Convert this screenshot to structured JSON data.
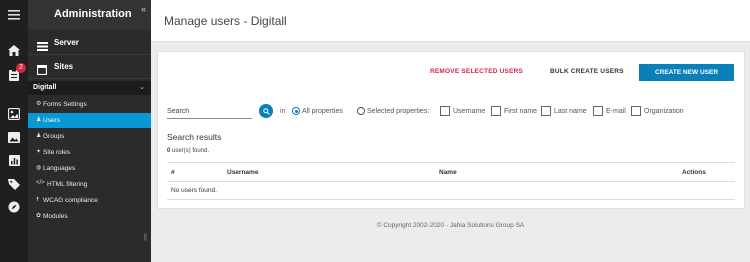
{
  "rail": {
    "icons": [
      "hamburger-icon",
      "home-icon",
      "tasks-icon",
      "tag-icon",
      "image-icon",
      "chart-icon",
      "label-icon",
      "compass-icon"
    ],
    "badge_count": "2",
    "badge_color": "#d9263b"
  },
  "sidebar": {
    "title": "Administration",
    "collapse_glyph": "«",
    "sections": [
      {
        "label": "Server",
        "icon": "server-icon"
      },
      {
        "label": "Sites",
        "icon": "sites-icon"
      }
    ],
    "site": {
      "label": "Digitall",
      "chevron": "⌄"
    },
    "items": [
      {
        "label": "Forms Settings",
        "icon": "gear-icon",
        "active": false
      },
      {
        "label": "Users",
        "icon": "user-icon",
        "active": true
      },
      {
        "label": "Groups",
        "icon": "group-icon",
        "active": false
      },
      {
        "label": "Site roles",
        "icon": "roles-icon",
        "active": false
      },
      {
        "label": "Languages",
        "icon": "globe-icon",
        "active": false
      },
      {
        "label": "HTML filtering",
        "icon": "filter-icon",
        "active": false
      },
      {
        "label": "WCAG compliance",
        "icon": "accessibility-icon",
        "active": false
      },
      {
        "label": "Modules",
        "icon": "module-icon",
        "active": false
      }
    ],
    "grip": "||",
    "accent": "#0a97d6"
  },
  "header": {
    "title": "Manage users - Digitall"
  },
  "actions": {
    "remove_label": "REMOVE SELECTED USERS",
    "bulk_label": "BULK CREATE USERS",
    "create_label": "CREATE NEW USER",
    "remove_color": "#d6224b",
    "create_color": "#0a7fb8"
  },
  "search": {
    "placeholder": "Search",
    "in_label": "in",
    "all_properties": "All properties",
    "selected_properties": "Selected properties:",
    "properties": [
      "Username",
      "First name",
      "Last name",
      "E-mail",
      "Organization"
    ],
    "selected_mode": "all"
  },
  "results": {
    "title": "Search results",
    "count": "0",
    "count_suffix": " user(s) found.",
    "columns": [
      "#",
      "Username",
      "Name",
      "Actions"
    ],
    "empty_message": "No users found."
  },
  "footer": {
    "copyright": "© Copyright 2002-2020 - Jahia Solutions Group SA"
  }
}
